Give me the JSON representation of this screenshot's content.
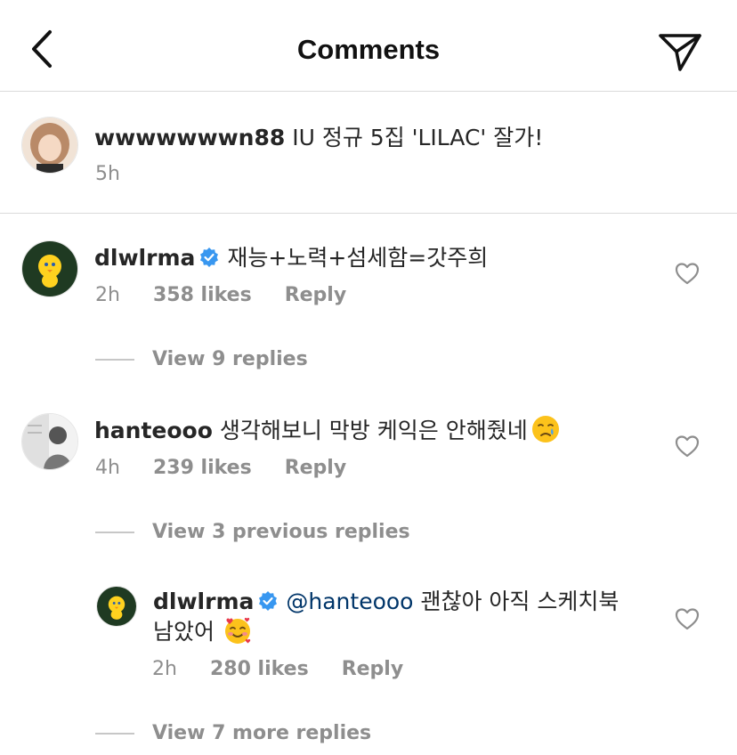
{
  "header": {
    "title": "Comments"
  },
  "caption": {
    "username": "wwwwwwwn88",
    "text": "IU 정규 5집 'LILAC' 잘가!",
    "time": "5h"
  },
  "comments": [
    {
      "username": "dlwlrma",
      "verified": true,
      "text": "재능+노력+섬세함=갓주희",
      "time": "2h",
      "likes": "358 likes",
      "reply_label": "Reply",
      "view_replies": "View 9 replies"
    },
    {
      "username": "hanteooo",
      "verified": false,
      "text": "생각해보니 막방 케익은 안해줬네",
      "emoji": "crying-face",
      "time": "4h",
      "likes": "239 likes",
      "reply_label": "Reply",
      "view_replies": "View 3 previous replies"
    }
  ],
  "reply": {
    "username": "dlwlrma",
    "verified": true,
    "mention": "@hanteooo",
    "text_line1": "괜찮아 아직 스케치북",
    "text_line2": "남았어",
    "emoji": "smiling-face-with-hearts",
    "time": "2h",
    "likes": "280 likes",
    "reply_label": "Reply",
    "view_more": "View 7 more replies"
  },
  "colors": {
    "verified_blue": "#3897f0",
    "mention_blue": "#003569",
    "meta_gray": "#8e8e8e",
    "divider": "#dbdbdb"
  }
}
